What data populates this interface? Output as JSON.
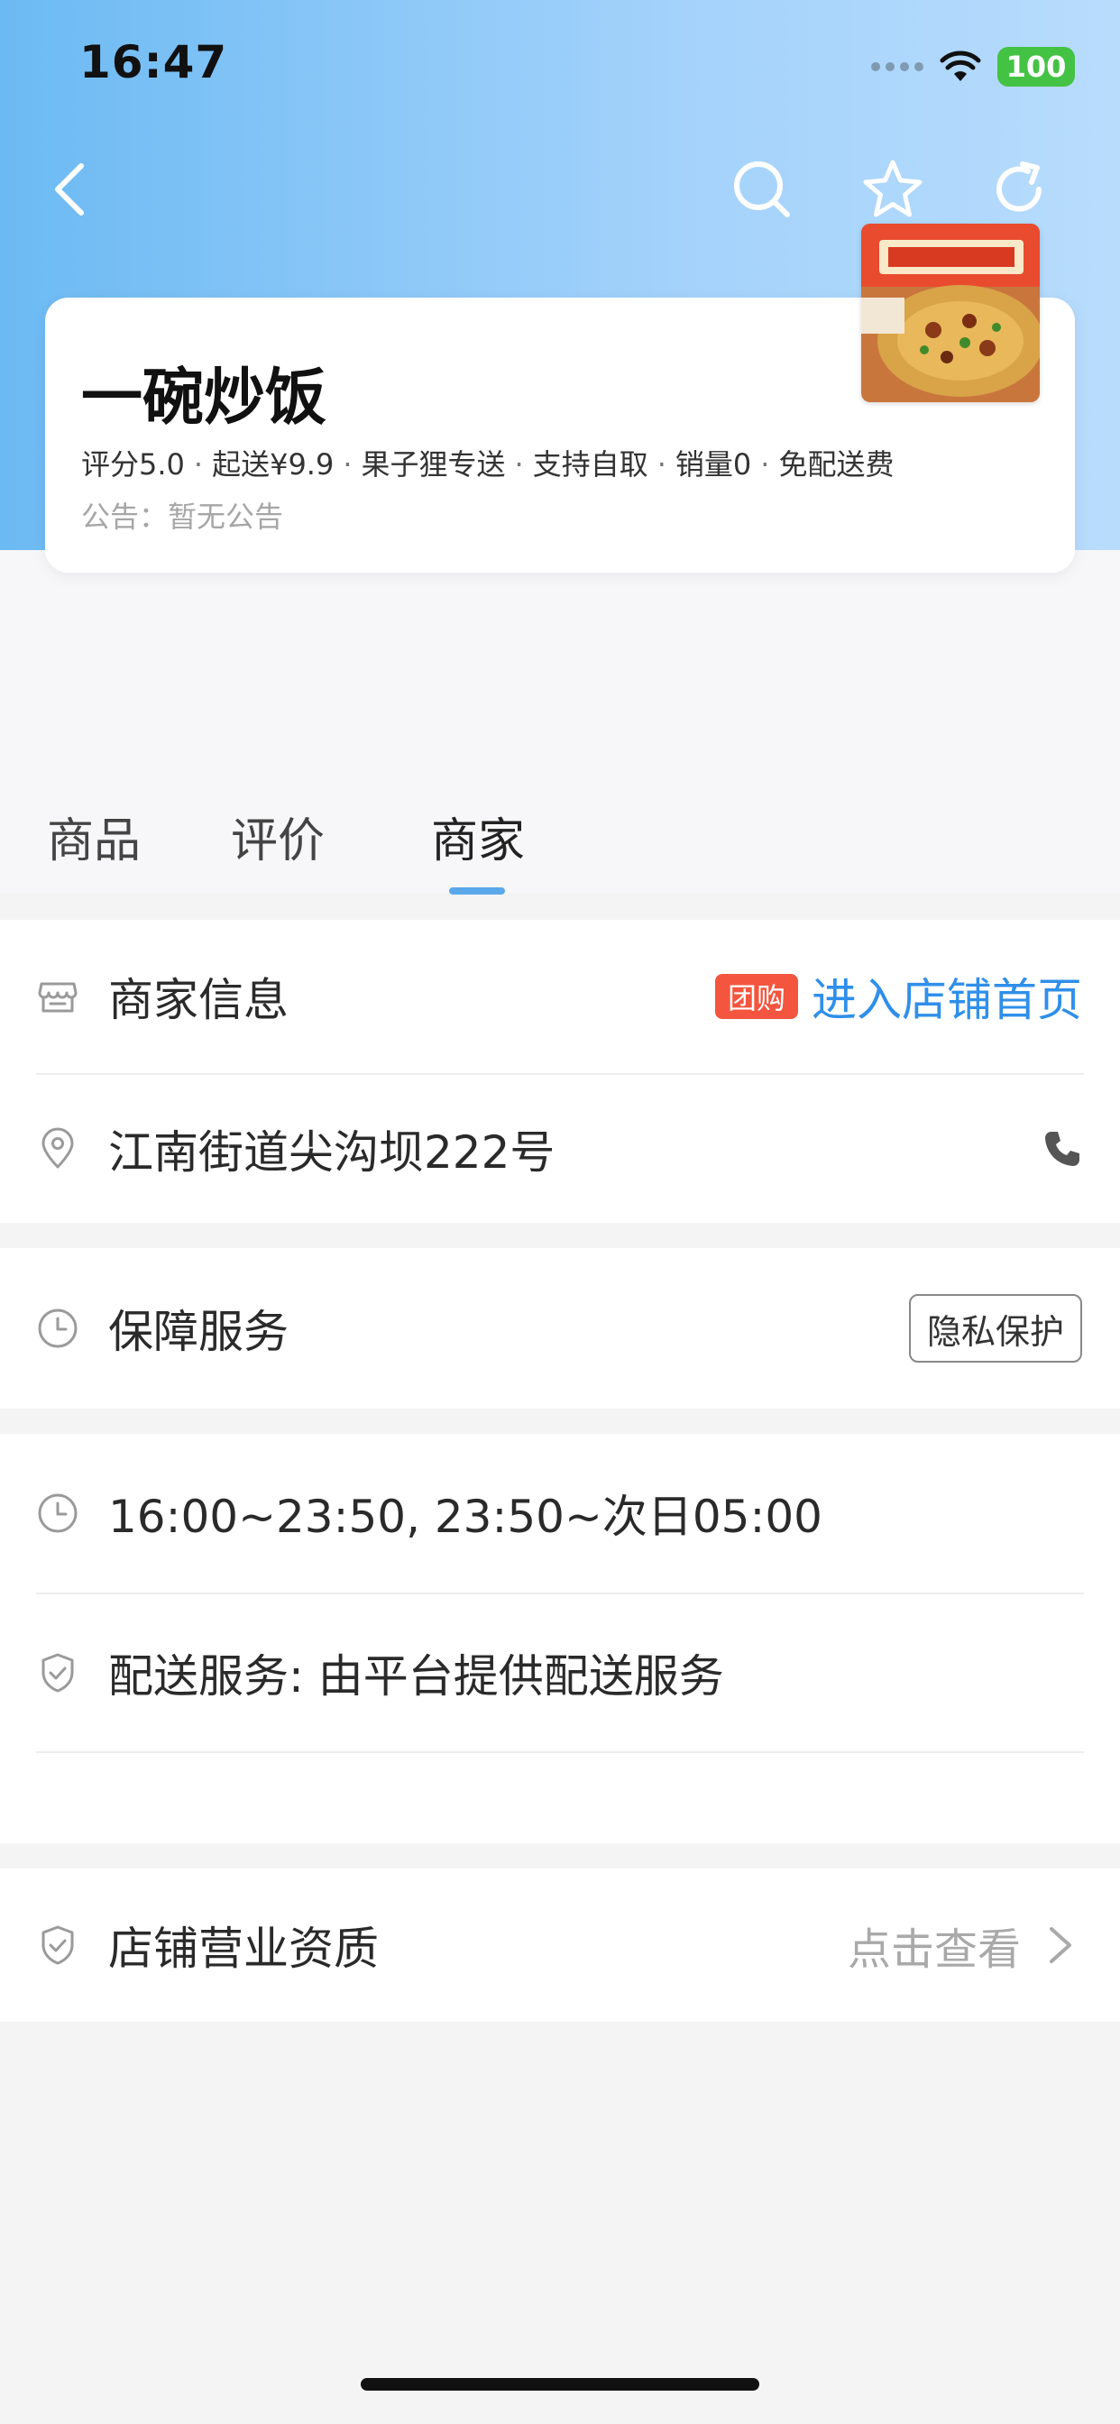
{
  "status_bar": {
    "time": "16:47",
    "battery": "100"
  },
  "header": {
    "back_icon": "chevron-left-icon",
    "search_icon": "search-icon",
    "favorite_icon": "star-icon",
    "share_icon": "share-icon"
  },
  "store": {
    "name": "一碗炒饭",
    "meta": [
      "评分5.0",
      "起送¥9.9",
      "果子狸专送",
      "支持自取",
      "销量0",
      "免配送费"
    ],
    "meta_separator": "·",
    "notice": "公告：暂无公告"
  },
  "tabs": [
    {
      "label": "商品",
      "active": false
    },
    {
      "label": "评价",
      "active": false
    },
    {
      "label": "商家",
      "active": true
    }
  ],
  "merchant": {
    "info_label": "商家信息",
    "group_buy_tag": "团购",
    "enter_store_link": "进入店铺首页",
    "address": "江南街道尖沟坝222号"
  },
  "guarantee": {
    "label": "保障服务",
    "privacy_button": "隐私保护"
  },
  "service": {
    "hours": "16:00~23:50, 23:50~次日05:00",
    "delivery": "配送服务: 由平台提供配送服务"
  },
  "qualification": {
    "label": "店铺营业资质",
    "view_link": "点击查看"
  },
  "colors": {
    "accent": "#2f8fea",
    "tab_indicator": "#5aa8ea",
    "group_buy_tag": "#f4553f",
    "header_gradient_start": "#6cbaf3",
    "header_gradient_end": "#b8dcfc"
  }
}
